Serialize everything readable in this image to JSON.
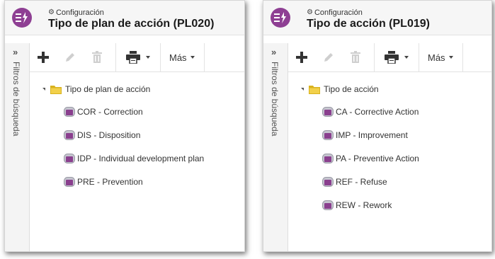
{
  "panels": [
    {
      "config_label": "Configuración",
      "title": "Tipo de plan de acción (PL020)",
      "sidebar_label": "Filtros de búsqueda",
      "toolbar": {
        "more_label": "Más"
      },
      "tree": {
        "root_label": "Tipo de plan de acción",
        "items": [
          {
            "label": "COR - Correction"
          },
          {
            "label": "DIS - Disposition"
          },
          {
            "label": "IDP - Individual development plan"
          },
          {
            "label": "PRE - Prevention"
          }
        ]
      }
    },
    {
      "config_label": "Configuración",
      "title": "Tipo de acción (PL019)",
      "sidebar_label": "Filtros de búsqueda",
      "toolbar": {
        "more_label": "Más"
      },
      "tree": {
        "root_label": "Tipo de acción",
        "items": [
          {
            "label": "CA - Corrective Action"
          },
          {
            "label": "IMP - Improvement"
          },
          {
            "label": "PA - Preventive Action"
          },
          {
            "label": "REF - Refuse"
          },
          {
            "label": "REW - Rework"
          }
        ]
      }
    }
  ],
  "icons": {
    "app": "action-plan-icon",
    "settings": "gear-icon",
    "expand_filters": "double-chevron-right-icon",
    "add": "plus-icon",
    "edit": "pencil-icon",
    "delete": "trash-icon",
    "print": "printer-icon",
    "folder": "folder-icon",
    "item": "record-icon"
  },
  "colors": {
    "app_icon": "#8e3f93",
    "folder": "#d8b21e",
    "item_icon": "#8a3f8e"
  }
}
